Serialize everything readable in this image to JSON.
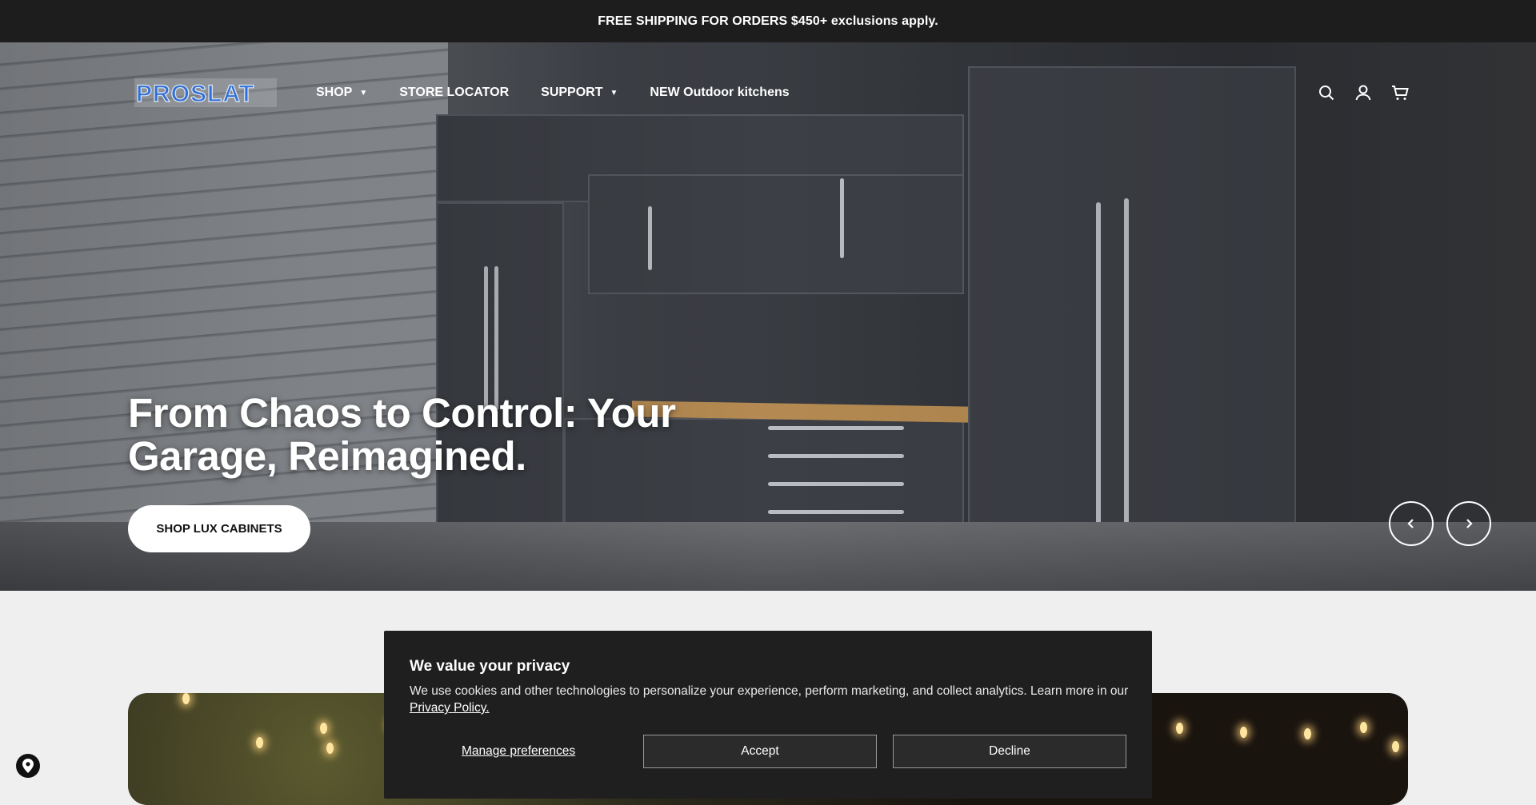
{
  "announcement": {
    "text": "FREE SHIPPING FOR ORDERS $450+ exclusions apply."
  },
  "logo": {
    "text": "PROSLAT",
    "accent": "#2f6fd6"
  },
  "nav": {
    "items": [
      {
        "label": "SHOP",
        "has_dropdown": true
      },
      {
        "label": "STORE LOCATOR",
        "has_dropdown": false
      },
      {
        "label": "SUPPORT",
        "has_dropdown": true
      },
      {
        "label": "NEW Outdoor kitchens",
        "has_dropdown": false
      }
    ]
  },
  "header_icons": [
    "search-icon",
    "account-icon",
    "cart-icon"
  ],
  "hero": {
    "headline": "From Chaos to Control:  Your Garage, Reimagined.",
    "cta_label": "SHOP LUX CABINETS",
    "prev_icon": "chevron-left-icon",
    "next_icon": "chevron-right-icon"
  },
  "cookie_banner": {
    "title": "We value your privacy",
    "body": "We use cookies and other technologies to personalize your experience, perform marketing, and collect analytics. Learn more in our ",
    "policy_link": "Privacy Policy.",
    "manage_label": "Manage preferences",
    "accept_label": "Accept",
    "decline_label": "Decline"
  },
  "store_locator_icon": "map-pin-icon"
}
